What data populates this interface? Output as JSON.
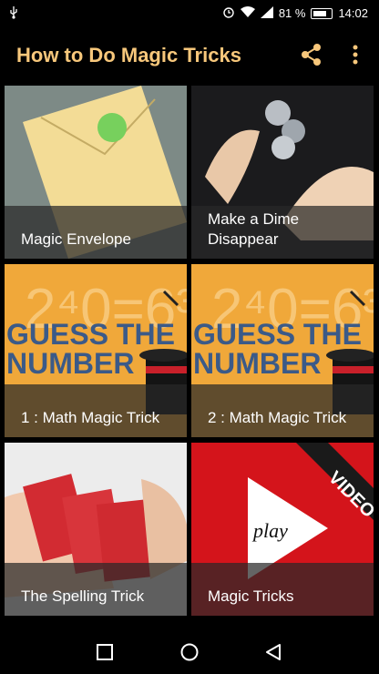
{
  "status_bar": {
    "battery": "81 %",
    "time": "14:02"
  },
  "app_bar": {
    "title": "How to Do Magic Tricks",
    "share_icon": "share-icon",
    "more_icon": "more-vertical-icon"
  },
  "tiles": [
    {
      "label": "Magic Envelope"
    },
    {
      "label": "Make a Dime Disappear"
    },
    {
      "label": "1 : Math Magic Trick",
      "art_text_1": "GUESS THE",
      "art_text_2": "NUMBER"
    },
    {
      "label": "2 : Math Magic Trick",
      "art_text_1": "GUESS THE",
      "art_text_2": "NUMBER"
    },
    {
      "label": "The Spelling Trick"
    },
    {
      "label": "Magic Tricks",
      "art_banner": "VIDEO",
      "art_play": "play"
    }
  ],
  "nav_bar": {
    "icons": [
      "recent-apps-icon",
      "home-icon",
      "back-icon"
    ]
  },
  "colors": {
    "title": "#f7c77b",
    "orange_tile": "#f0a83a",
    "video_tile": "#d4141b"
  }
}
